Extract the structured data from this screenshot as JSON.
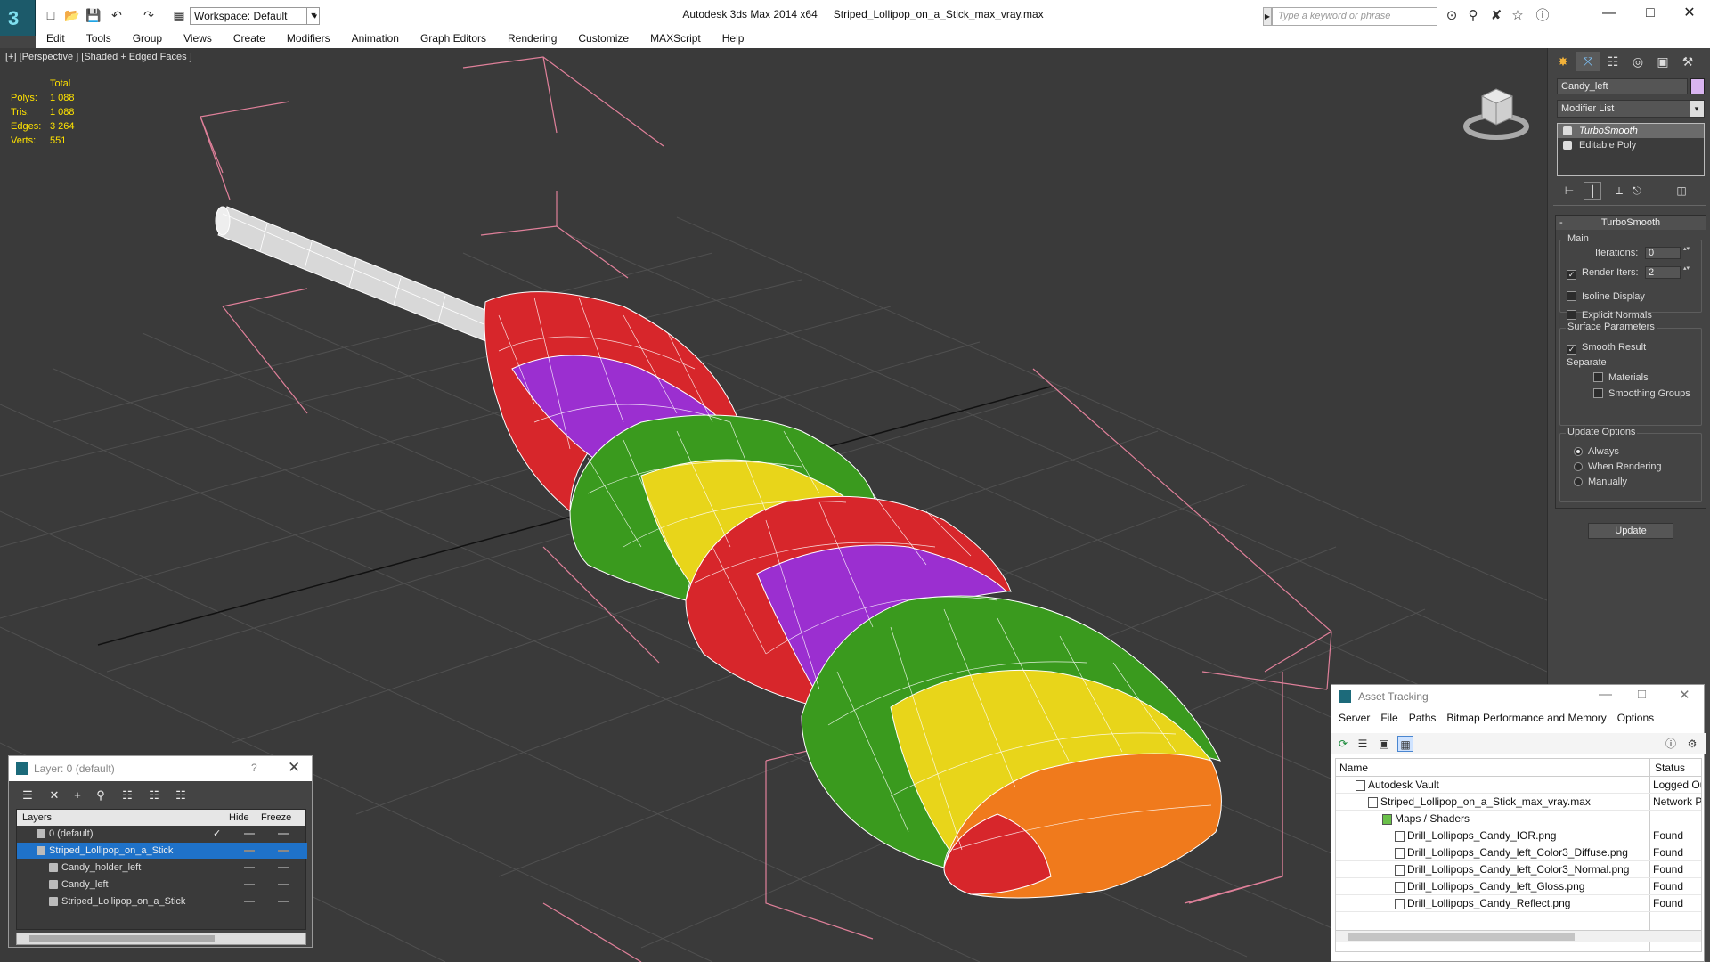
{
  "title_bar": {
    "app": "Autodesk 3ds Max  2014 x64",
    "file": "Striped_Lollipop_on_a_Stick_max_vray.max",
    "workspace": "Workspace: Default",
    "search_placeholder": "Type a keyword or phrase"
  },
  "menu": [
    "Edit",
    "Tools",
    "Group",
    "Views",
    "Create",
    "Modifiers",
    "Animation",
    "Graph Editors",
    "Rendering",
    "Customize",
    "MAXScript",
    "Help"
  ],
  "viewport": {
    "label": "[+] [Perspective ] [Shaded + Edged Faces ]",
    "stats": {
      "header": "Total",
      "rows": [
        {
          "k": "Polys:",
          "v": "1 088"
        },
        {
          "k": "Tris:",
          "v": "1 088"
        },
        {
          "k": "Edges:",
          "v": "3 264"
        },
        {
          "k": "Verts:",
          "v": "551"
        }
      ]
    },
    "colors": {
      "bg": "#3a3a3a",
      "grid": "#555555",
      "bbox": "#e0809a",
      "stats": "#ffe200"
    }
  },
  "command_panel": {
    "object_name": "Candy_left",
    "object_color": "#d9b5f0",
    "modifier_list": "Modifier List",
    "stack": [
      "TurboSmooth",
      "Editable Poly"
    ],
    "rollout_title": "TurboSmooth",
    "main_group": "Main",
    "iterations_label": "Iterations:",
    "iterations_value": "0",
    "render_iters_label": "Render Iters:",
    "render_iters_value": "2",
    "isoline_display": "Isoline Display",
    "explicit_normals": "Explicit Normals",
    "surface_group": "Surface Parameters",
    "smooth_result": "Smooth Result",
    "separate_label": "Separate",
    "materials": "Materials",
    "smoothing_groups": "Smoothing Groups",
    "update_group": "Update Options",
    "always": "Always",
    "when_rendering": "When Rendering",
    "manually": "Manually",
    "update_button": "Update"
  },
  "layer_window": {
    "title": "Layer: 0 (default)",
    "help": "?",
    "col_layers": "Layers",
    "col_hide": "Hide",
    "col_freeze": "Freeze",
    "rows": [
      "0 (default)",
      "Striped_Lollipop_on_a_Stick",
      "Candy_holder_left",
      "Candy_left",
      "Striped_Lollipop_on_a_Stick"
    ]
  },
  "asset_window": {
    "title": "Asset Tracking",
    "menu": [
      "Server",
      "File",
      "Paths",
      "Bitmap Performance and Memory",
      "Options"
    ],
    "col_name": "Name",
    "col_status": "Status",
    "rows": [
      {
        "name": "Autodesk Vault",
        "status": "Logged Ou"
      },
      {
        "name": "Striped_Lollipop_on_a_Stick_max_vray.max",
        "status": "Network P"
      },
      {
        "name": "Maps / Shaders",
        "status": ""
      },
      {
        "name": "Drill_Lollipops_Candy_IOR.png",
        "status": "Found"
      },
      {
        "name": "Drill_Lollipops_Candy_left_Color3_Diffuse.png",
        "status": "Found"
      },
      {
        "name": "Drill_Lollipops_Candy_left_Color3_Normal.png",
        "status": "Found"
      },
      {
        "name": "Drill_Lollipops_Candy_left_Gloss.png",
        "status": "Found"
      },
      {
        "name": "Drill_Lollipops_Candy_Reflect.png",
        "status": "Found"
      }
    ]
  }
}
